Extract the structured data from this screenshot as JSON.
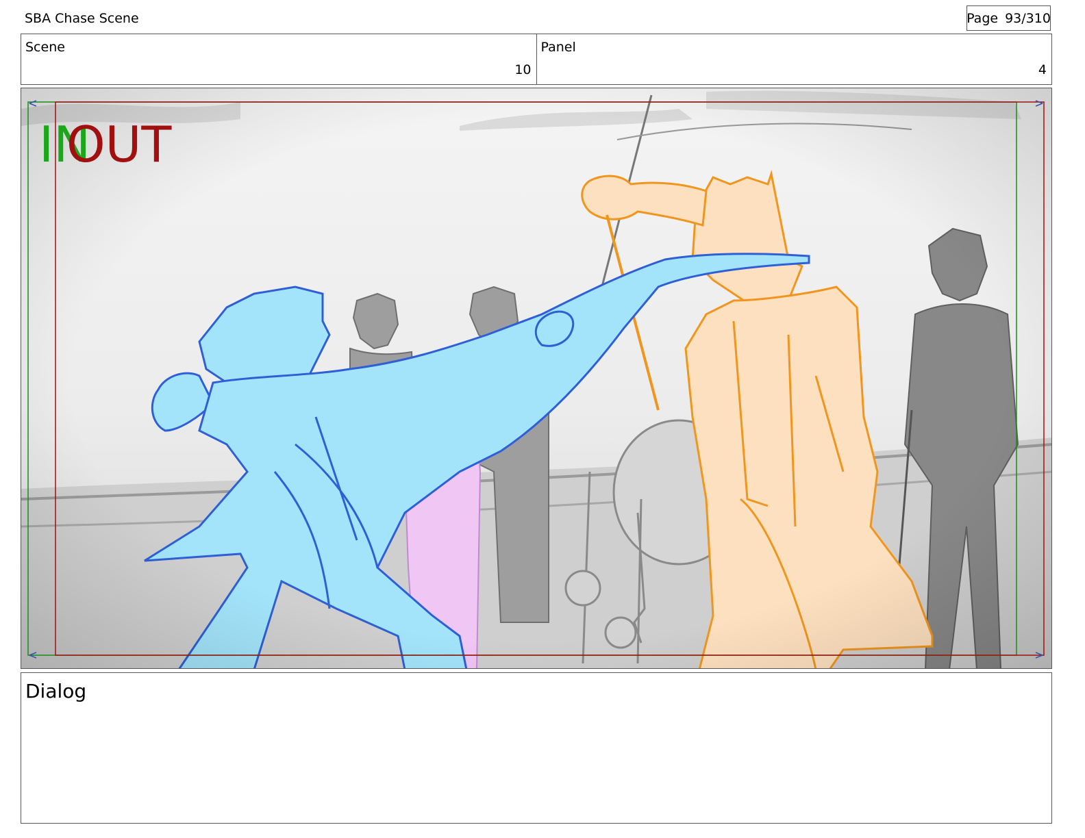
{
  "header": {
    "project_title": "SBA Chase Scene",
    "page_label": "Page",
    "page_number": "93/310"
  },
  "info": {
    "scene_label": "Scene",
    "scene_value": "10",
    "panel_label": "Panel",
    "panel_value": "4"
  },
  "panel_overlay": {
    "in_marker": "IN",
    "out_marker": "OUT",
    "in_color": "#1aa81a",
    "out_color": "#a01010"
  },
  "sketch_colors": {
    "hero": "#a3e4fa",
    "hero_line": "#2f5fd6",
    "villain": "#fde0bf",
    "villain_line": "#f0961e",
    "extra": "#f0c6f5",
    "background": "#8a8a8a"
  },
  "dialog": {
    "label": "Dialog"
  }
}
